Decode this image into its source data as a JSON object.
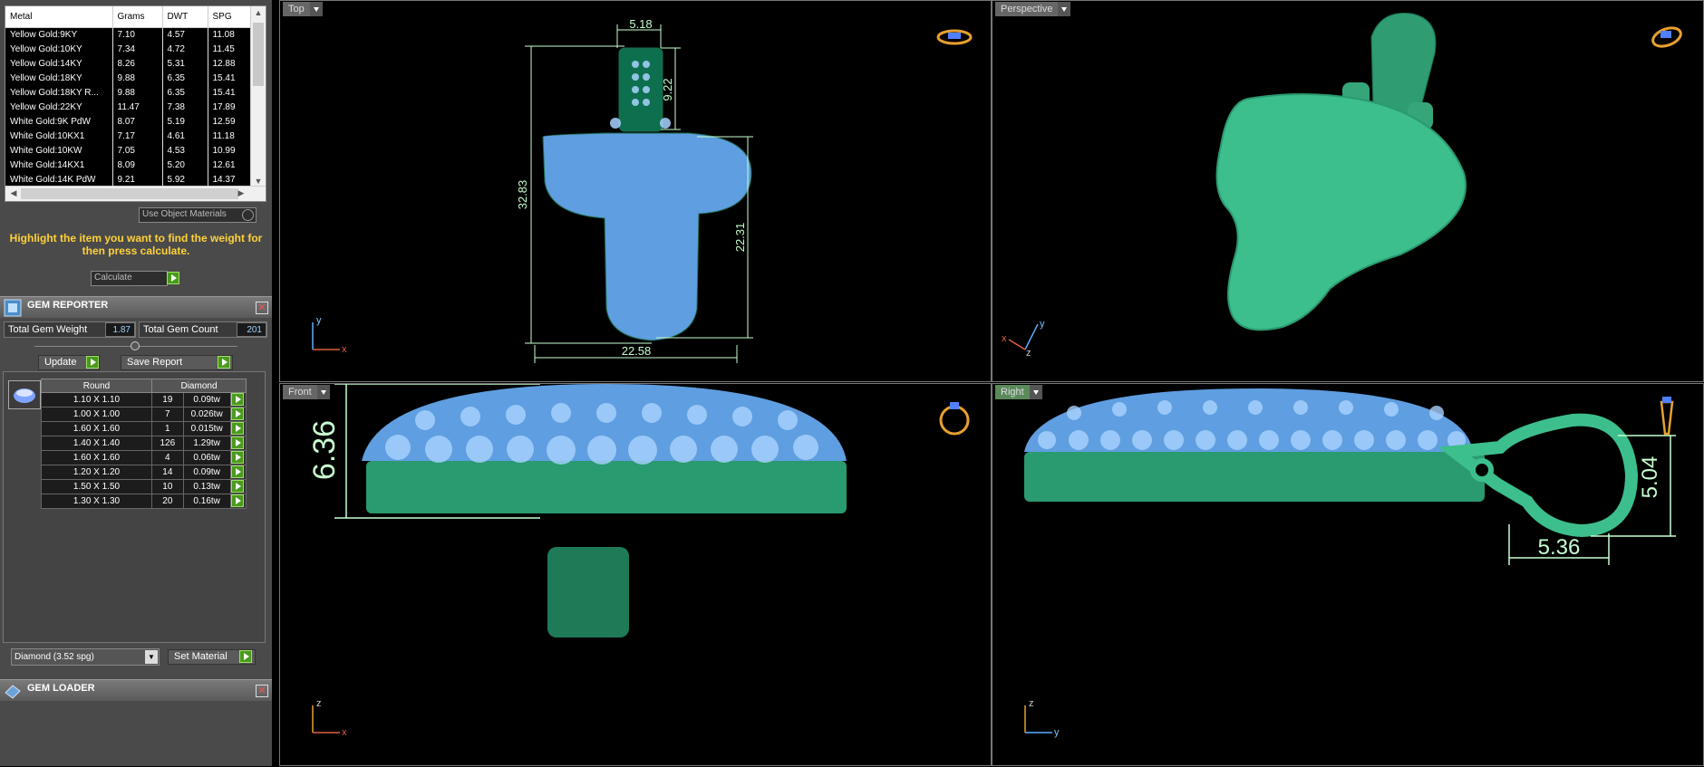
{
  "metal_table": {
    "headers": [
      "Metal",
      "Grams",
      "DWT",
      "SPG"
    ],
    "rows": [
      [
        "Yellow Gold:9KY",
        "7.10",
        "4.57",
        "11.08"
      ],
      [
        "Yellow Gold:10KY",
        "7.34",
        "4.72",
        "11.45"
      ],
      [
        "Yellow Gold:14KY",
        "8.26",
        "5.31",
        "12.88"
      ],
      [
        "Yellow Gold:18KY",
        "9.88",
        "6.35",
        "15.41"
      ],
      [
        "Yellow Gold:18KY R...",
        "9.88",
        "6.35",
        "15.41"
      ],
      [
        "Yellow Gold:22KY",
        "11.47",
        "7.38",
        "17.89"
      ],
      [
        "White Gold:9K PdW",
        "8.07",
        "5.19",
        "12.59"
      ],
      [
        "White Gold:10KX1",
        "7.17",
        "4.61",
        "11.18"
      ],
      [
        "White Gold:10KW",
        "7.05",
        "4.53",
        "10.99"
      ],
      [
        "White Gold:14KX1",
        "8.09",
        "5.20",
        "12.61"
      ],
      [
        "White Gold:14K PdW",
        "9.21",
        "5.92",
        "14.37"
      ]
    ]
  },
  "use_object_materials": "Use Object Materials",
  "hint": "Highlight the item you want to find the weight for then press calculate.",
  "calculate_label": "Calculate",
  "gem_reporter": {
    "title": "GEM REPORTER",
    "total_weight_label": "Total Gem Weight",
    "total_weight": "1.87",
    "total_count_label": "Total Gem Count",
    "total_count": "201",
    "update_label": "Update",
    "save_label": "Save Report",
    "col_shape": "Round",
    "col_material": "Diamond",
    "rows": [
      [
        "1.10 X 1.10",
        "19",
        "0.09tw"
      ],
      [
        "1.00 X 1.00",
        "7",
        "0.026tw"
      ],
      [
        "1.60 X 1.60",
        "1",
        "0.015tw"
      ],
      [
        "1.40 X 1.40",
        "126",
        "1.29tw"
      ],
      [
        "1.60 X 1.60",
        "4",
        "0.06tw"
      ],
      [
        "1.20 X 1.20",
        "14",
        "0.09tw"
      ],
      [
        "1.50 X 1.50",
        "10",
        "0.13tw"
      ],
      [
        "1.30 X 1.30",
        "20",
        "0.16tw"
      ]
    ],
    "material_select": "Diamond    (3.52 spg)",
    "set_material_label": "Set Material"
  },
  "gem_loader": {
    "title": "GEM LOADER"
  },
  "viewports": {
    "top": {
      "label": "Top",
      "dims": [
        "5.18",
        "9.22",
        "32.83",
        "22.31",
        "22.58"
      ]
    },
    "perspective": {
      "label": "Perspective"
    },
    "front": {
      "label": "Front",
      "dims": [
        "6.36"
      ]
    },
    "right": {
      "label": "Right",
      "dims": [
        "5.04",
        "5.36"
      ]
    }
  },
  "axes": {
    "x": "x",
    "y": "y",
    "z": "z"
  },
  "colors": {
    "model": "#3cbf8c",
    "stones": "#6fa8ff",
    "dimension": "#c8ffd0",
    "highlight_text": "#ffd23a"
  }
}
